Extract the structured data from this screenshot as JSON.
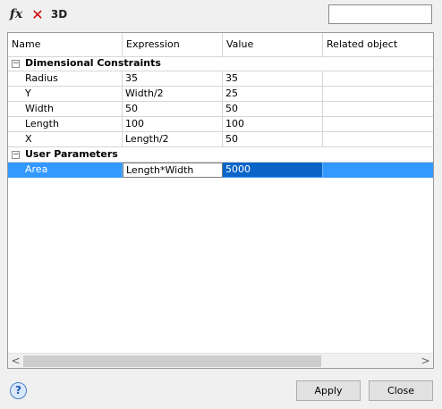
{
  "toolbar": {
    "fx_label": "fx",
    "delete_label": "✕",
    "threed_label": "3D",
    "search_value": ""
  },
  "grid": {
    "columns": [
      "Name",
      "Expression",
      "Value",
      "Related object"
    ],
    "groups": [
      {
        "title": "Dimensional Constraints",
        "toggle": "−",
        "rows": [
          {
            "name": "Radius",
            "expression": "35",
            "value": "35",
            "related": ""
          },
          {
            "name": "Y",
            "expression": "Width/2",
            "value": "25",
            "related": ""
          },
          {
            "name": "Width",
            "expression": "50",
            "value": "50",
            "related": ""
          },
          {
            "name": "Length",
            "expression": "100",
            "value": "100",
            "related": ""
          },
          {
            "name": "X",
            "expression": "Length/2",
            "value": "50",
            "related": ""
          }
        ]
      },
      {
        "title": "User Parameters",
        "toggle": "−",
        "rows": [
          {
            "name": "Area",
            "expression": "Length*Width",
            "value": "5000",
            "related": "",
            "selected": true
          }
        ]
      }
    ],
    "scroll_left": "<",
    "scroll_right": ">"
  },
  "footer": {
    "help_label": "?",
    "apply_label": "Apply",
    "close_label": "Close"
  },
  "colors": {
    "selection": "#3399ff",
    "delete_icon": "#d10000",
    "background": "#f0f0f0"
  }
}
